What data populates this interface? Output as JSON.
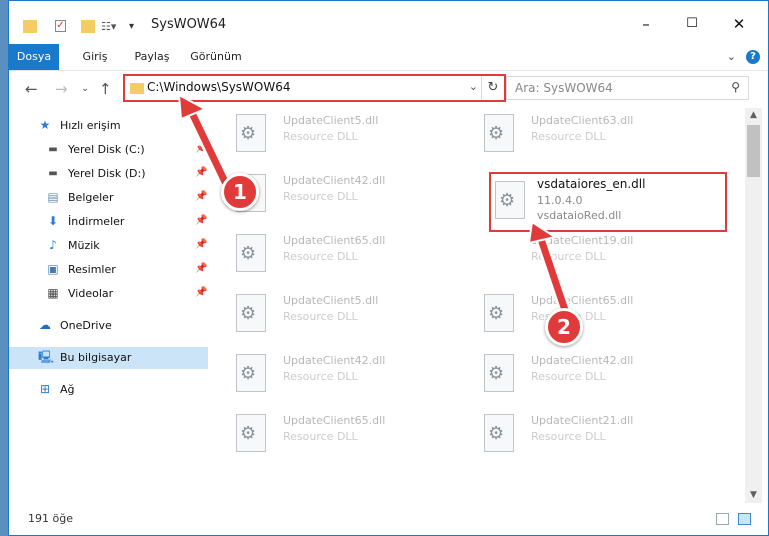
{
  "window": {
    "title": "SysWOW64",
    "minimize": "–",
    "maximize": "☐",
    "close": "✕"
  },
  "ribbon": {
    "tabs": [
      "Dosya",
      "Giriş",
      "Paylaş",
      "Görünüm"
    ],
    "active_tab": "Dosya",
    "help": "?"
  },
  "address": {
    "path": "C:\\Windows\\SysWOW64",
    "search_placeholder": "Ara: SysWOW64"
  },
  "sidebar": {
    "quick_access": "Hızlı erişim",
    "items": [
      {
        "label": "Yerel Disk (C:)",
        "icon": "drive-icon"
      },
      {
        "label": "Yerel Disk (D:)",
        "icon": "drive-icon"
      },
      {
        "label": "Belgeler",
        "icon": "documents-icon"
      },
      {
        "label": "İndirmeler",
        "icon": "download-icon"
      },
      {
        "label": "Müzik",
        "icon": "music-icon"
      },
      {
        "label": "Resimler",
        "icon": "pictures-icon"
      },
      {
        "label": "Videolar",
        "icon": "video-icon"
      }
    ],
    "onedrive": "OneDrive",
    "this_pc": "Bu bilgisayar",
    "network": "Ağ"
  },
  "files": {
    "left_column": [
      {
        "name": "UpdateClient5.dll",
        "type": "Resource DLL"
      },
      {
        "name": "UpdateClient42.dll",
        "type": "Resource DLL"
      },
      {
        "name": "UpdateClient65.dll",
        "type": "Resource DLL"
      },
      {
        "name": "UpdateClient5.dll",
        "type": "Resource DLL"
      },
      {
        "name": "UpdateClient42.dll",
        "type": "Resource DLL"
      },
      {
        "name": "UpdateClient65.dll",
        "type": "Resource DLL"
      }
    ],
    "right_column": [
      {
        "name": "UpdateClient63.dll",
        "type": "Resource DLL"
      },
      {
        "name": "UpdateClient19.dll",
        "type": "Resource DLL"
      },
      {
        "name": "UpdateClient65.dll",
        "type": "Resource DLL"
      },
      {
        "name": "UpdateClient42.dll",
        "type": "Resource DLL"
      },
      {
        "name": "UpdateClient21.dll",
        "type": "Resource DLL"
      }
    ],
    "highlighted": {
      "name": "vsdataiores_en.dll",
      "version": "11.0.4.0",
      "description": "vsdataioRed.dll"
    }
  },
  "status": {
    "item_count": "191 öğe"
  },
  "annotations": {
    "step1": "1",
    "step2": "2",
    "color": "#e13a3a"
  }
}
